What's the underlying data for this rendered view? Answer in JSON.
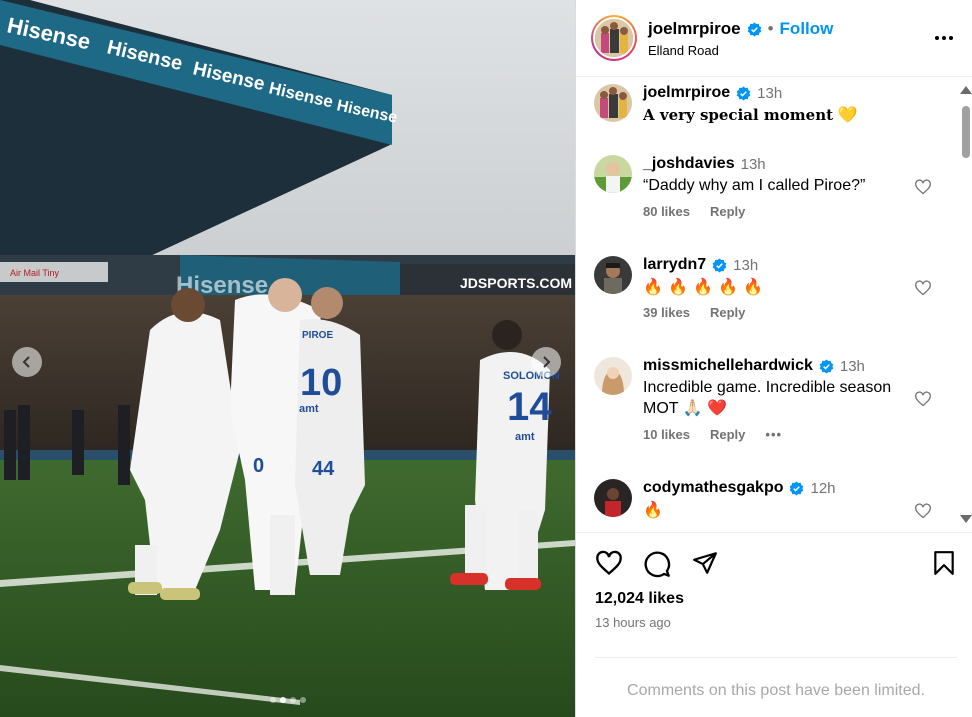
{
  "photo": {
    "ad_brand": "Hisense",
    "ad_sponsor": "JDSPORTS.COM",
    "ad_airline": "Air Mail Tiny",
    "player_names": [
      "SOLOMON",
      "PIROE"
    ],
    "player_numbers": [
      "14",
      "10",
      "44",
      "0"
    ],
    "kit_sponsor": "amt",
    "carousel_count": 4,
    "carousel_active": 2
  },
  "header": {
    "username": "joelmrpiroe",
    "separator": "•",
    "follow_label": "Follow",
    "location": "Elland Road"
  },
  "caption": {
    "username": "joelmrpiroe",
    "time": "13h",
    "text": "A very special moment",
    "emoji": "💛"
  },
  "comments": [
    {
      "username": "_joshdavies",
      "verified": false,
      "time": "13h",
      "text": "“Daddy why am I called Piroe?”",
      "likes": "80 likes",
      "reply": "Reply"
    },
    {
      "username": "larrydn7",
      "verified": true,
      "time": "13h",
      "text": "🔥 🔥 🔥 🔥 🔥",
      "likes": "39 likes",
      "reply": "Reply"
    },
    {
      "username": "missmichellehardwick",
      "verified": true,
      "time": "13h",
      "text": "Incredible game. Incredible season MOT 🙏🏻 ❤️",
      "likes": "10 likes",
      "reply": "Reply",
      "more": "•••"
    },
    {
      "username": "codymathesgakpo",
      "verified": true,
      "time": "12h",
      "text": "🔥"
    }
  ],
  "footer": {
    "likes": "12,024 likes",
    "time_ago": "13 hours ago",
    "limited_notice": "Comments on this post have been limited."
  },
  "colors": {
    "accent": "#0095f6",
    "verified": "#0095f6",
    "muted": "#737373",
    "heart_red": "#e0245e"
  },
  "icons": {
    "like": "heart-outline-icon",
    "comment": "speech-bubble-icon",
    "share": "paper-plane-icon",
    "save": "bookmark-icon",
    "more": "ellipsis-icon",
    "verified": "verified-badge-icon"
  }
}
